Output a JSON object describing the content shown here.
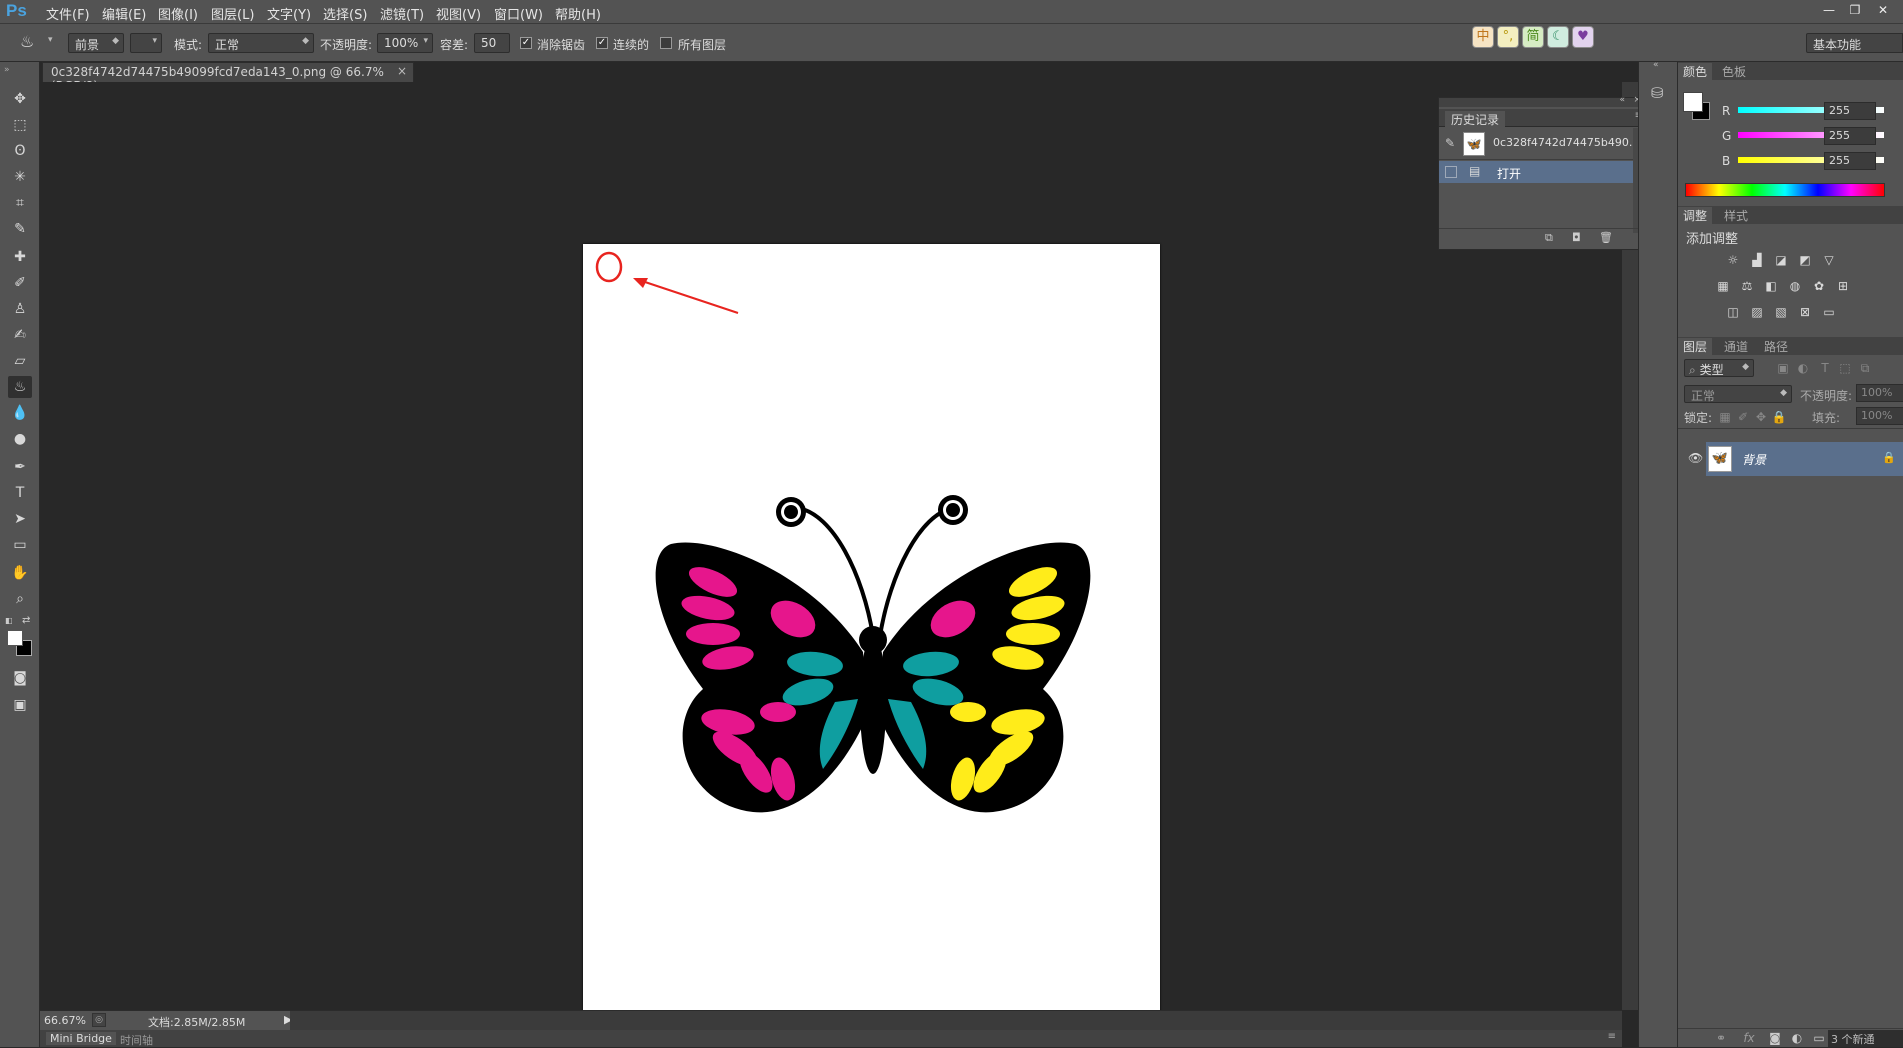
{
  "app": {
    "logo": "Ps"
  },
  "menubar": {
    "items": [
      "文件(F)",
      "编辑(E)",
      "图像(I)",
      "图层(L)",
      "文字(Y)",
      "选择(S)",
      "滤镜(T)",
      "视图(V)",
      "窗口(W)",
      "帮助(H)"
    ]
  },
  "window_controls": {
    "minimize": "—",
    "restore": "❐",
    "close": "✕"
  },
  "options": {
    "fill_source": "前景",
    "mode_label": "模式:",
    "mode_value": "正常",
    "opacity_label": "不透明度:",
    "opacity_value": "100%",
    "tolerance_label": "容差:",
    "tolerance_value": "50",
    "antialias_label": "消除锯齿",
    "antialias_checked": "✓",
    "contiguous_label": "连续的",
    "contiguous_checked": "✓",
    "all_layers_label": "所有图层",
    "all_layers_checked": "",
    "workspace": "基本功能"
  },
  "ime": [
    "中",
    "°,",
    "简",
    "☾",
    "♥"
  ],
  "document": {
    "tab_title": "0c328f4742d74475b49099fcd7eda143_0.png @ 66.7%(RGB/8)",
    "close": "×"
  },
  "status": {
    "zoom": "66.67%",
    "doc_size": "文档:2.85M/2.85M"
  },
  "bottom": {
    "mini_bridge": "Mini Bridge",
    "timeline": "时间轴"
  },
  "history_panel": {
    "tab": "历史记录",
    "snapshot_label": "0c328f4742d74475b490...",
    "steps": [
      "打开"
    ]
  },
  "color_panel": {
    "tabs": [
      "颜色",
      "色板"
    ],
    "channels": [
      {
        "name": "R",
        "value": "255"
      },
      {
        "name": "G",
        "value": "255"
      },
      {
        "name": "B",
        "value": "255"
      }
    ]
  },
  "adjust_panel": {
    "tabs": [
      "调整",
      "样式"
    ],
    "title": "添加调整"
  },
  "layers_panel": {
    "tabs": [
      "图层",
      "通道",
      "路径"
    ],
    "filter_kind": "类型",
    "blend_mode": "正常",
    "opacity_label": "不透明度:",
    "opacity_value": "100%",
    "lock_label": "锁定:",
    "fill_label": "填充:",
    "fill_value": "100%",
    "layers": [
      {
        "name": "背景"
      }
    ],
    "footer_note": "3 个新通"
  },
  "colors": {
    "annotation": "#e8241f",
    "butterfly_black": "#000000",
    "magenta": "#e6168c",
    "teal": "#0f9ea0",
    "yellow": "#ffec1a",
    "selected_row": "#5a6f8c"
  }
}
